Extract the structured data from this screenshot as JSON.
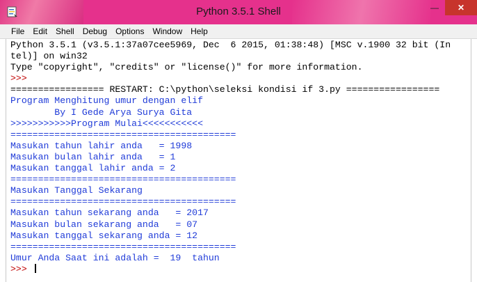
{
  "window": {
    "title": "Python 3.5.1 Shell",
    "controls": {
      "minimize": "—",
      "close": "✕"
    }
  },
  "menu": [
    "File",
    "Edit",
    "Shell",
    "Debug",
    "Options",
    "Window",
    "Help"
  ],
  "lines": [
    {
      "text": "Python 3.5.1 (v3.5.1:37a07cee5969, Dec  6 2015, 01:38:48) [MSC v.1900 32 bit (In",
      "color": "black"
    },
    {
      "text": "tel)] on win32",
      "color": "black"
    },
    {
      "text": "Type \"copyright\", \"credits\" or \"license()\" for more information.",
      "color": "black"
    },
    {
      "text": ">>> ",
      "color": "red"
    },
    {
      "text": "================= RESTART: C:\\python\\seleksi kondisi if 3.py =================",
      "color": "black"
    },
    {
      "text": "Program Menghitung umur dengan elif",
      "color": "blue"
    },
    {
      "text": "        By I Gede Arya Surya Gita",
      "color": "blue"
    },
    {
      "text": ">>>>>>>>>>>Program Mulai<<<<<<<<<<<",
      "color": "blue"
    },
    {
      "text": "=========================================",
      "color": "blue"
    },
    {
      "text": "Masukan tahun lahir anda   = 1998",
      "color": "blue"
    },
    {
      "text": "Masukan bulan lahir anda   = 1",
      "color": "blue"
    },
    {
      "text": "Masukan tanggal lahir anda = 2",
      "color": "blue"
    },
    {
      "text": "=========================================",
      "color": "blue"
    },
    {
      "text": "Masukan Tanggal Sekarang",
      "color": "blue"
    },
    {
      "text": "=========================================",
      "color": "blue"
    },
    {
      "text": "Masukan tahun sekarang anda   = 2017",
      "color": "blue"
    },
    {
      "text": "Masukan bulan sekarang anda   = 07",
      "color": "blue"
    },
    {
      "text": "Masukan tanggal sekarang anda = 12",
      "color": "blue"
    },
    {
      "text": "=========================================",
      "color": "blue"
    },
    {
      "text": "Umur Anda Saat ini adalah =  19  tahun",
      "color": "blue"
    },
    {
      "text": ">>> ",
      "color": "red",
      "cursor": true
    }
  ],
  "colors": {
    "black": "#000000",
    "blue": "#1f3bd8",
    "red": "#c00000",
    "titlebar": "#e5318c"
  }
}
